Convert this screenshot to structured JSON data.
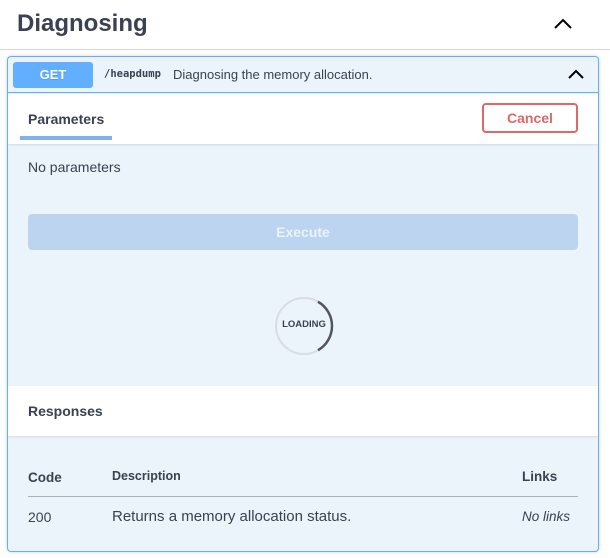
{
  "section": {
    "title": "Diagnosing"
  },
  "operation": {
    "method": "GET",
    "path": "/heapdump",
    "description": "Diagnosing the memory allocation.",
    "method_color": "#61affe"
  },
  "parameters": {
    "tab_label": "Parameters",
    "cancel_label": "Cancel",
    "empty_text": "No parameters",
    "execute_label": "Execute",
    "loading_text": "LOADING"
  },
  "responses": {
    "title": "Responses",
    "columns": {
      "code": "Code",
      "description": "Description",
      "links": "Links"
    },
    "rows": [
      {
        "code": "200",
        "description": "Returns a memory allocation status.",
        "links": "No links"
      }
    ]
  },
  "icons": {
    "section_toggle": "chevron-up-icon",
    "operation_toggle": "chevron-up-icon",
    "loading": "loading-spinner-icon"
  }
}
